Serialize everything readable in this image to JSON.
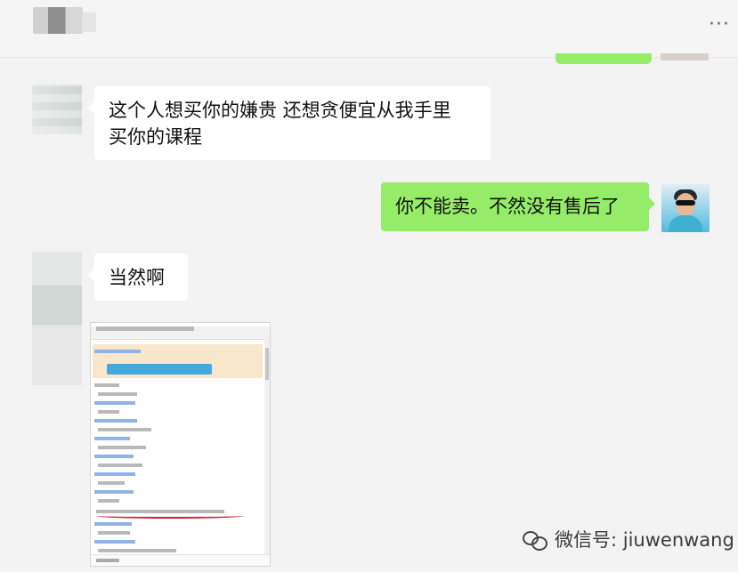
{
  "header": {
    "more_label": "···"
  },
  "messages": [
    {
      "side": "left",
      "lines": [
        "这个人想买你的嫌贵 还想贪便宜从我手里",
        "买你的课程"
      ]
    },
    {
      "side": "right",
      "text": "你不能卖。不然没有售后了"
    },
    {
      "side": "left",
      "text": "当然啊"
    }
  ],
  "watermark": {
    "text": "微信号: jiuwenwang",
    "icon": "wechat-icon"
  },
  "colors": {
    "background": "#f3f3f3",
    "incoming_bubble": "#ffffff",
    "outgoing_bubble": "#95ec69"
  }
}
